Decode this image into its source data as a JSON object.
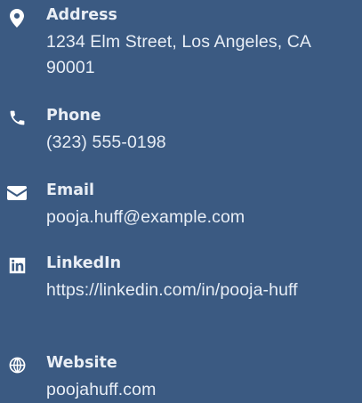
{
  "contact_items": [
    {
      "icon": "location-pin-icon",
      "label": "Address",
      "value": "1234 Elm Street, Los Angeles, CA 90001"
    },
    {
      "icon": "phone-icon",
      "label": "Phone",
      "value": "(323) 555-0198"
    },
    {
      "icon": "envelope-icon",
      "label": "Email",
      "value": "pooja.huff@example.com"
    },
    {
      "icon": "linkedin-icon",
      "label": "LinkedIn",
      "value": "https://linkedin.com/in/pooja-huff"
    },
    {
      "icon": "globe-icon",
      "label": "Website",
      "value": "poojahuff.com"
    }
  ],
  "colors": {
    "background": "#3b5a82",
    "text": "#ffffff"
  }
}
